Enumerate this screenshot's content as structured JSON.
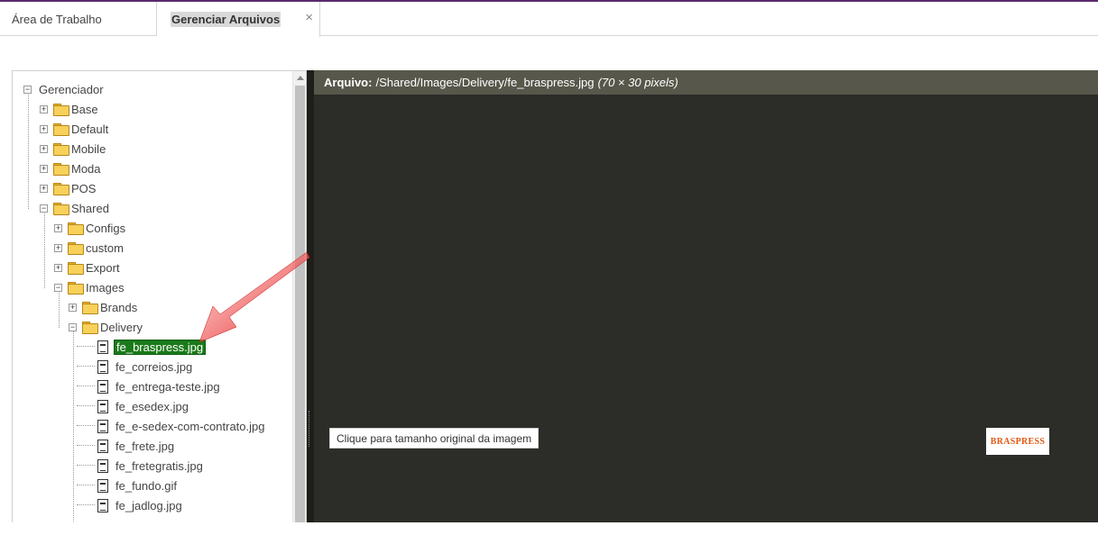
{
  "tabs": [
    {
      "label": "Área de Trabalho",
      "active": false
    },
    {
      "label": "Gerenciar Arquivos",
      "active": true,
      "close": "×"
    }
  ],
  "tree": {
    "root": "Gerenciador",
    "folders_top": [
      "Base",
      "Default",
      "Mobile",
      "Moda",
      "POS",
      "Shared"
    ],
    "shared_children": [
      "Configs",
      "custom",
      "Export",
      "Images"
    ],
    "images_children": [
      "Brands",
      "Delivery"
    ],
    "delivery_files": [
      "fe_braspress.jpg",
      "fe_correios.jpg",
      "fe_entrega-teste.jpg",
      "fe_esedex.jpg",
      "fe_e-sedex-com-contrato.jpg",
      "fe_frete.jpg",
      "fe_fretegratis.jpg",
      "fe_fundo.gif",
      "fe_jadlog.jpg"
    ],
    "selected_file": "fe_braspress.jpg"
  },
  "preview": {
    "label": "Arquivo:",
    "path": "/Shared/Images/Delivery/fe_braspress.jpg",
    "dimensions": "(70 × 30 pixels)",
    "original_size_button": "Clique para tamanho original da imagem",
    "thumbnail_text": "BRASPRESS"
  },
  "colors": {
    "accent_top": "#5b2a6e",
    "selected_bg": "#1a7a1a",
    "preview_bg": "#2c2c28",
    "preview_header_bg": "#58574b",
    "arrow": "#e02020"
  }
}
